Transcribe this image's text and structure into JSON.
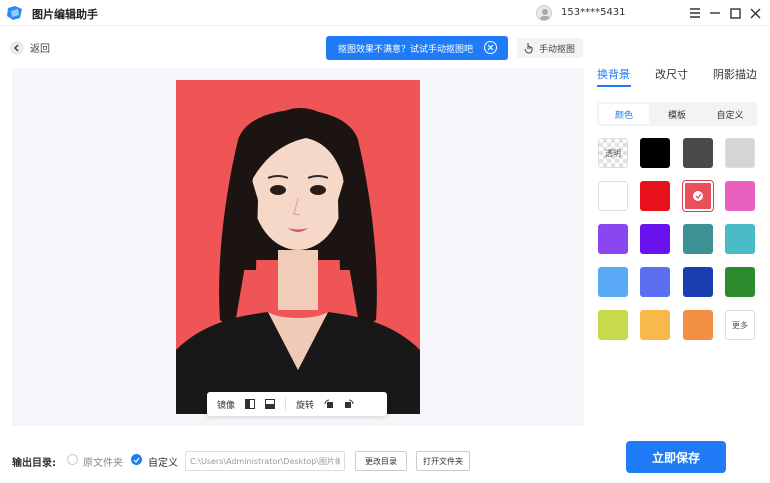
{
  "app": {
    "title": "图片编辑助手",
    "phone": "153****5431"
  },
  "nav": {
    "back_label": "返回"
  },
  "tip": {
    "text": "抠图效果不满意？试试手动抠图吧"
  },
  "manual": {
    "label": "手动抠图"
  },
  "toolbar": {
    "mirror_label": "镜像",
    "rotate_label": "旋转"
  },
  "right_tabs": [
    {
      "label": "换背景"
    },
    {
      "label": "改尺寸"
    },
    {
      "label": "阴影描边"
    }
  ],
  "segments": [
    {
      "label": "颜色"
    },
    {
      "label": "模板"
    },
    {
      "label": "自定义"
    }
  ],
  "swatches": {
    "transparent_label": "透明",
    "more_label": "更多",
    "colors": [
      "#000000",
      "#4a4a4a",
      "#d5d5d5",
      "#ffffff",
      "#e8101a",
      "#e8505a",
      "#e960c0",
      "#8c46f0",
      "#6a12ee",
      "#3b9194",
      "#49bcc8",
      "#5aaaf7",
      "#5a6ff0",
      "#1a3fb0",
      "#2d8a2c",
      "#c6da4c",
      "#f6b94a",
      "#f28f44"
    ],
    "selected": "#e8505a"
  },
  "bottom": {
    "output_label": "输出目录:",
    "option_original": "原文件夹",
    "option_custom": "自定义",
    "path_value": "C:\\Users\\Administrator\\Desktop\\图片编辑",
    "change_dir_label": "更改目录",
    "open_folder_label": "打开文件夹",
    "save_label": "立即保存"
  },
  "colors": {
    "accent": "#1f7cf6",
    "photo_bg": "#ef5456",
    "canvas_bg": "#f4f6f9"
  }
}
